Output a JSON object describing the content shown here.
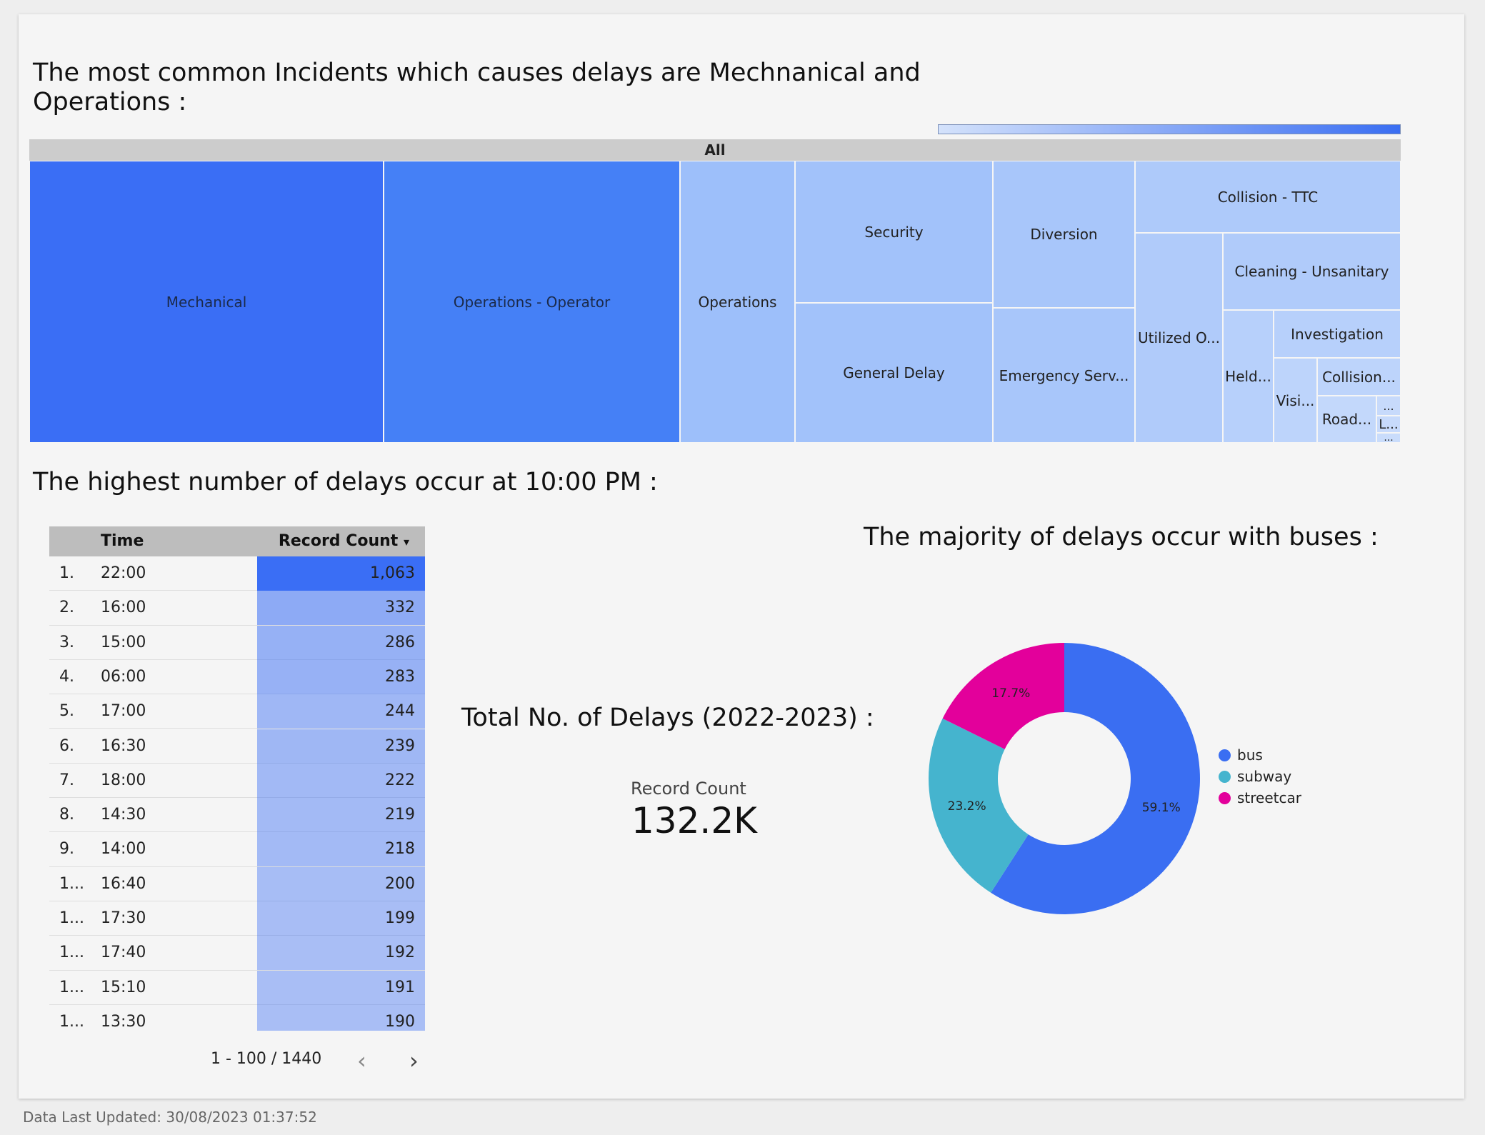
{
  "headings": {
    "treemap": "The most common Incidents which causes delays are Mechnanical and Operations :",
    "table": "The highest number of delays occur at 10:00 PM :",
    "pie": "The majority of delays occur with buses :",
    "total": "Total No. of Delays (2022-2023) :"
  },
  "treemap": {
    "root_label": "All",
    "color_scale": [
      "#d4e2fb",
      "#3a6ef2"
    ],
    "cells": [
      {
        "label": "Mechanical",
        "color": "#3a6ef5"
      },
      {
        "label": "Operations - Operator",
        "color": "#4580f6"
      },
      {
        "label": "Operations",
        "color": "#9dbffa"
      },
      {
        "label": "Security",
        "color": "#a2c2fa"
      },
      {
        "label": "General Delay",
        "color": "#a2c2fa"
      },
      {
        "label": "Diversion",
        "color": "#a8c6fa"
      },
      {
        "label": "Emergency Serv...",
        "color": "#a8c6fa"
      },
      {
        "label": "Collision - TTC",
        "color": "#aecafa"
      },
      {
        "label": "Utilized O...",
        "color": "#b0cbfa"
      },
      {
        "label": "Cleaning - Unsanitary",
        "color": "#b0cbfa"
      },
      {
        "label": "Held...",
        "color": "#b7d0fb"
      },
      {
        "label": "Investigation",
        "color": "#b7d0fb"
      },
      {
        "label": "Visi...",
        "color": "#bdd4fb"
      },
      {
        "label": "Collision...",
        "color": "#bdd4fb"
      },
      {
        "label": "Road...",
        "color": "#c3d8fb"
      },
      {
        "label": "...",
        "color": "#c7dafb"
      },
      {
        "label": "L...",
        "color": "#c7dafb"
      },
      {
        "label": "...",
        "color": "#c9dcfb"
      }
    ]
  },
  "table": {
    "columns": [
      "Time",
      "Record Count"
    ],
    "sort_indicator": "▾",
    "bar_color": "#3a6ef5",
    "max_value": 1063,
    "rows": [
      {
        "idx": "1.",
        "time": "22:00",
        "count": "1,063",
        "value": 1063
      },
      {
        "idx": "2.",
        "time": "16:00",
        "count": "332",
        "value": 332
      },
      {
        "idx": "3.",
        "time": "15:00",
        "count": "286",
        "value": 286
      },
      {
        "idx": "4.",
        "time": "06:00",
        "count": "283",
        "value": 283
      },
      {
        "idx": "5.",
        "time": "17:00",
        "count": "244",
        "value": 244
      },
      {
        "idx": "6.",
        "time": "16:30",
        "count": "239",
        "value": 239
      },
      {
        "idx": "7.",
        "time": "18:00",
        "count": "222",
        "value": 222
      },
      {
        "idx": "8.",
        "time": "14:30",
        "count": "219",
        "value": 219
      },
      {
        "idx": "9.",
        "time": "14:00",
        "count": "218",
        "value": 218
      },
      {
        "idx": "1...",
        "time": "16:40",
        "count": "200",
        "value": 200
      },
      {
        "idx": "1...",
        "time": "17:30",
        "count": "199",
        "value": 199
      },
      {
        "idx": "1...",
        "time": "17:40",
        "count": "192",
        "value": 192
      },
      {
        "idx": "1...",
        "time": "15:10",
        "count": "191",
        "value": 191
      },
      {
        "idx": "1...",
        "time": "13:30",
        "count": "190",
        "value": 190
      }
    ],
    "pagination": "1 - 100 / 1440",
    "prev_icon": "‹",
    "next_icon": "›"
  },
  "scorecard": {
    "label": "Record Count",
    "value": "132.2K"
  },
  "chart_data": {
    "type": "pie",
    "donut": true,
    "categories": [
      "bus",
      "subway",
      "streetcar"
    ],
    "values": [
      59.1,
      23.2,
      17.7
    ],
    "value_labels": [
      "59.1%",
      "23.2%",
      "17.7%"
    ],
    "colors": [
      "#3a6ef2",
      "#45b4ce",
      "#e3009b"
    ],
    "legend_position": "right"
  },
  "footer": {
    "text": "Data Last Updated: 30/08/2023 01:37:52"
  }
}
